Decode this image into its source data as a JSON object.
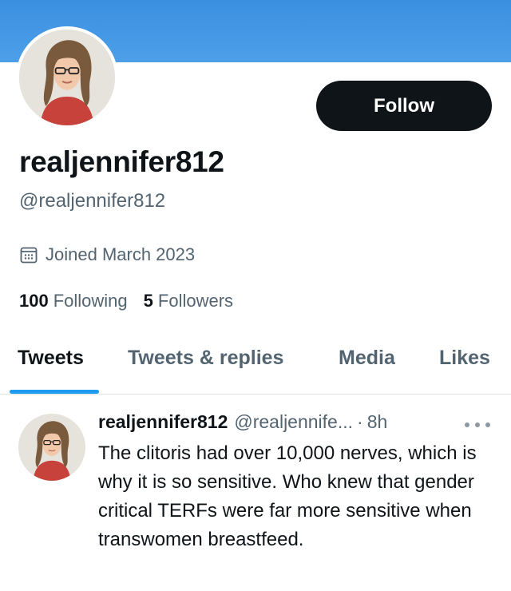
{
  "profile": {
    "display_name": "realjennifer812",
    "handle": "@realjennifer812",
    "joined": "Joined March 2023",
    "follow_label": "Follow",
    "following_count": "100",
    "following_label": "Following",
    "followers_count": "5",
    "followers_label": "Followers",
    "banner_color": "#4d9fe8"
  },
  "tabs": [
    {
      "label": "Tweets",
      "active": true
    },
    {
      "label": "Tweets & replies",
      "active": false
    },
    {
      "label": "Media",
      "active": false
    },
    {
      "label": "Likes",
      "active": false
    }
  ],
  "tweet": {
    "author_name": "realjennifer812",
    "author_handle": "@realjennife...",
    "separator": "·",
    "time": "8h",
    "text": "The clitoris had over 10,000 nerves, which is why it is so sensitive. Who knew that gender critical TERFs were far more sensitive when transwomen breastfeed."
  },
  "icons": {
    "calendar": "calendar-icon",
    "more": "more-horizontal-icon"
  },
  "colors": {
    "accent": "#1d9bf0",
    "follow_button": "#0f1419",
    "secondary_text": "#536471"
  }
}
